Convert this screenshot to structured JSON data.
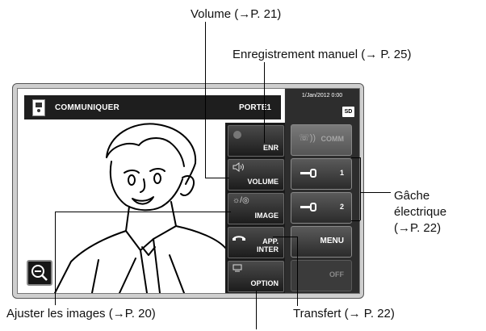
{
  "callouts": {
    "volume": "Volume (→P. 21)",
    "manual_recording": "Enregistrement manuel (→ P. 25)",
    "door_release_line1": "Gâche",
    "door_release_line2": "électrique",
    "door_release_line3": "(→P. 22)",
    "adjust_images": "Ajuster les images (→P. 20)",
    "transfer": "Transfert (→ P. 22)"
  },
  "screen": {
    "title": "COMMUNIQUER",
    "door": "PORTE1",
    "datetime": "1/Jan/2012 0:00",
    "sd_label": "SD"
  },
  "menu": {
    "record": "ENR",
    "volume": "VOLUME",
    "image": "IMAGE",
    "transfer_line1": "APP.",
    "transfer_line2": "INTER",
    "option": "OPTION"
  },
  "right_panel": {
    "comm": "COMM",
    "lock1": "1",
    "lock2": "2",
    "menu": "MENU",
    "off": "OFF"
  },
  "icons": {
    "volume_icon": "speaker-icon",
    "image_icon": "brightness-icon",
    "transfer_icon": "handset-icon",
    "option_icon": "monitor-icon",
    "zoom_icon": "zoom-out-icon",
    "door_icon": "door-station-icon",
    "lock_icon": "key-icon"
  }
}
